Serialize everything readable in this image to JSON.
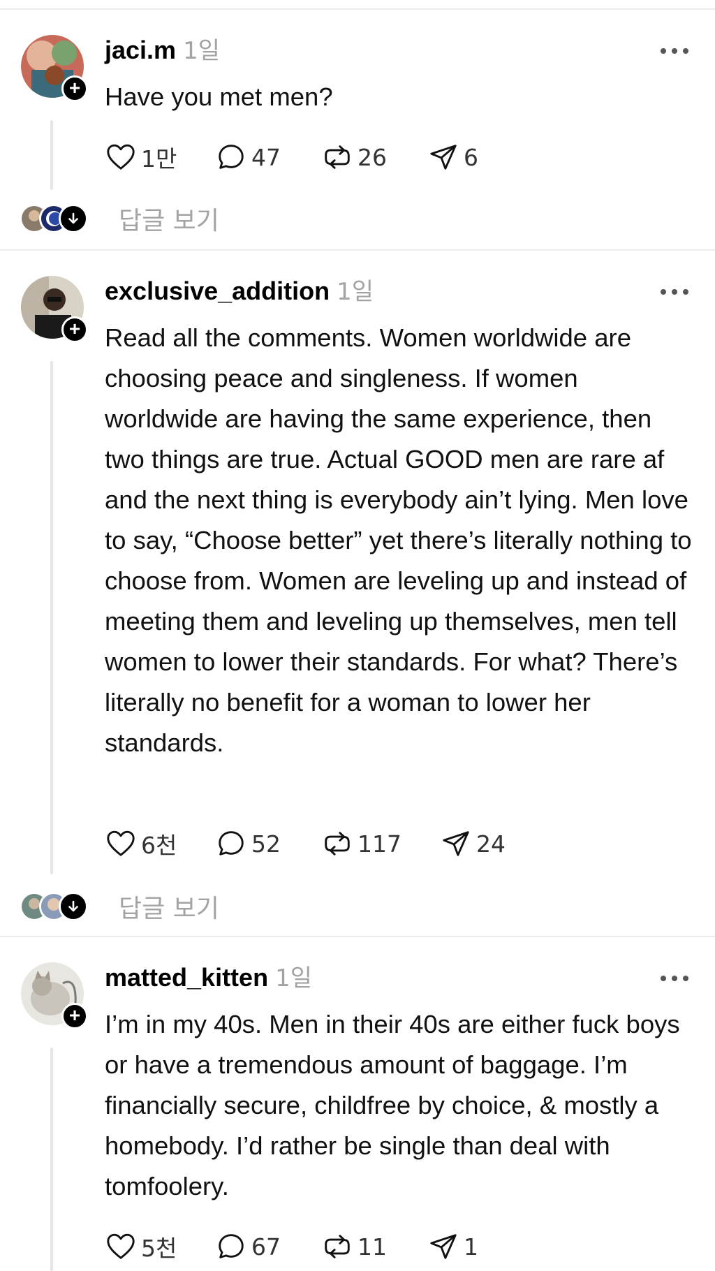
{
  "posts": [
    {
      "username": "jaci.m",
      "time": "1일",
      "text": "Have you met men?",
      "likes": "1만",
      "comments": "47",
      "reposts": "26",
      "shares": "6",
      "view_replies": "답글 보기"
    },
    {
      "username": "exclusive_addition",
      "time": "1일",
      "text": "Read all the comments. Women worldwide are choosing peace and singleness. If women worldwide are having the same experience, then two things are true. Actual GOOD men are rare af and the next thing is everybody ain’t lying. Men love to say, “Choose better” yet there’s literally nothing to choose from. Women are leveling up and instead of meeting them and leveling up themselves, men tell women to lower their standards. For what? There’s literally no benefit for a woman to lower her standards.",
      "likes": "6천",
      "comments": "52",
      "reposts": "117",
      "shares": "24",
      "view_replies": "답글 보기"
    },
    {
      "username": "matted_kitten",
      "time": "1일",
      "text": "I’m in my 40s. Men in their 40s are either fuck boys or have a tremendous amount of baggage. I’m financially secure, childfree by choice, & mostly a homebody. I’d rather be single than deal with tomfoolery.",
      "likes": "5천",
      "comments": "67",
      "reposts": "11",
      "shares": "1"
    }
  ],
  "icons": {
    "like": "heart-icon",
    "comment": "comment-bubble-icon",
    "repost": "repost-icon",
    "share": "send-icon",
    "more": "more-dots-icon",
    "follow": "follow-plus-icon",
    "view_replies": "arrow-down-icon"
  }
}
